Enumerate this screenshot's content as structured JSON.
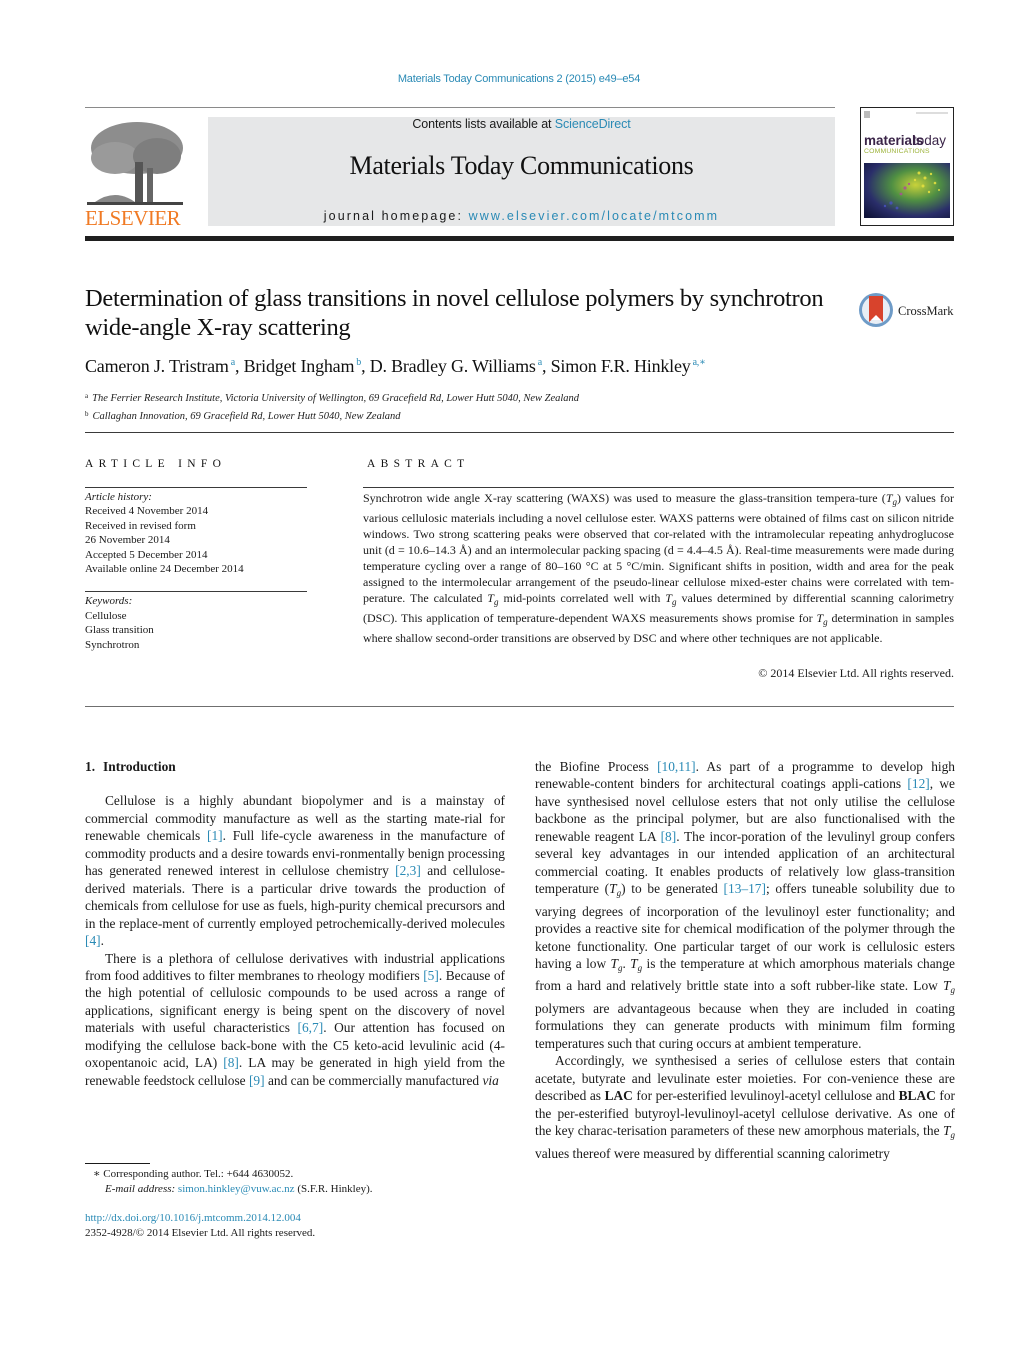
{
  "header": {
    "citation": "Materials Today Communications 2 (2015) e49–e54",
    "contents_prefix": "Contents lists available at ",
    "contents_link": "ScienceDirect",
    "journal_title": "Materials Today Communications",
    "homepage_prefix": "journal homepage: ",
    "homepage_link": "www.elsevier.com/locate/mtcomm",
    "publisher_logo_text": "ELSEVIER",
    "cover_title_bold": "materials",
    "cover_title_light": "today",
    "cover_subtitle": "COMMUNICATIONS"
  },
  "colors": {
    "link": "#2a8ab5",
    "elsevier_orange": "#f07a24",
    "masthead_gray": "#e6e7e8"
  },
  "article": {
    "title": "Determination of glass transitions in novel cellulose polymers by synchrotron wide-angle X-ray scattering",
    "crossmark_label": "CrossMark",
    "authors": [
      {
        "name": "Cameron J. Tristram",
        "aff": "a"
      },
      {
        "name": "Bridget Ingham",
        "aff": "b"
      },
      {
        "name": "D. Bradley G. Williams",
        "aff": "a"
      },
      {
        "name": "Simon F.R. Hinkley",
        "aff": "a,∗"
      }
    ],
    "affiliations": [
      {
        "key": "a",
        "text": "The Ferrier Research Institute, Victoria University of Wellington, 69 Gracefield Rd, Lower Hutt 5040, New Zealand"
      },
      {
        "key": "b",
        "text": "Callaghan Innovation, 69 Gracefield Rd, Lower Hutt 5040, New Zealand"
      }
    ]
  },
  "article_info": {
    "heading": "ARTICLE INFO",
    "history_label": "Article history:",
    "history": [
      "Received 4 November 2014",
      "Received in revised form",
      "26 November 2014",
      "Accepted 5 December 2014",
      "Available online 24 December 2014"
    ],
    "keywords_label": "Keywords:",
    "keywords": [
      "Cellulose",
      "Glass transition",
      "Synchrotron"
    ]
  },
  "abstract": {
    "heading": "ABSTRACT",
    "segments": [
      "Synchrotron wide angle X-ray scattering (WAXS) was used to measure the glass-transition tempera-ture (",
      ") values for various cellulosic materials including a novel cellulose ester. WAXS patterns were obtained of films cast on silicon nitride windows. Two strong scattering peaks were observed that cor-related with the intramolecular repeating anhydroglucose unit (d = 10.6–14.3 Å) and an intermolecular packing spacing (d = 4.4–4.5 Å). Real-time measurements were made during temperature cycling over a range of 80–160 °C at 5 °C/min. Significant shifts in position, width and area for the peak assigned to the intermolecular arrangement of the pseudo-linear cellulose mixed-ester chains were correlated with tem-perature. The calculated ",
      " mid-points correlated well with ",
      " values determined by differential scanning calorimetry (DSC). This application of temperature-dependent WAXS measurements shows promise for ",
      " determination in samples where shallow second-order transitions are observed by DSC and where other techniques are not applicable."
    ],
    "copyright": "© 2014 Elsevier Ltd. All rights reserved."
  },
  "symbols": {
    "T": "T",
    "g": "g"
  },
  "body": {
    "section_number": "1.",
    "section_title": "Introduction",
    "left": {
      "p1": [
        "Cellulose is a highly abundant biopolymer and is a mainstay of commercial commodity manufacture as well as the starting mate-rial for renewable chemicals ",
        "[1]",
        ". Full life-cycle awareness in the manufacture of commodity products and a desire towards envi-ronmentally benign processing has generated renewed interest in cellulose chemistry ",
        "[2,3]",
        " and cellulose-derived materials. There is a particular drive towards the production of chemicals from cellulose for use as fuels, high-purity chemical precursors and in the replace-ment of currently employed petrochemically-derived molecules ",
        "[4]",
        "."
      ],
      "p2": [
        "There is a plethora of cellulose derivatives with industrial applications from food additives to filter membranes to rheology modifiers ",
        "[5]",
        ". Because of the high potential of cellulosic compounds to be used across a range of applications, significant energy is being spent on the discovery of novel materials with useful characteristics ",
        "[6,7]",
        ". Our attention has focused on modifying the cellulose back-bone with the C5 keto-acid levulinic acid (4-oxopentanoic acid, LA) ",
        "[8]",
        ". LA may be generated in high yield from the renewable feedstock cellulose ",
        "[9]",
        " and can be commercially manufactured ",
        "via"
      ]
    },
    "right": {
      "p1": [
        "the Biofine Process ",
        "[10,11]",
        ". As part of a programme to develop high renewable-content binders for architectural coatings appli-cations ",
        "[12]",
        ", we have synthesised novel cellulose esters that not only utilise the cellulose backbone as the principal polymer, but are also functionalised with the renewable reagent LA ",
        "[8]",
        ". The incor-poration of the levulinyl group confers several key advantages in our intended application of an architectural commercial coating. It enables products of relatively low glass-transition temperature (",
        ") to be generated ",
        "[13–17]",
        "; offers tuneable solubility due to varying degrees of incorporation of the levulinoyl ester functionality; and provides a reactive site for chemical modification of the polymer through the ketone functionality. One particular target of our work is cellulosic esters having a low ",
        ". ",
        " is the temperature at which amorphous materials change from a hard and relatively brittle state into a soft rubber-like state. Low ",
        " polymers are advantageous because when they are included in coating formulations they can generate products with minimum film forming temperatures such that curing occurs at ambient temperature."
      ],
      "p2": [
        "Accordingly, we synthesised a series of cellulose esters that contain acetate, butyrate and levulinate ester moieties. For con-venience these are described as ",
        "LAC",
        " for per-esterified levulinoyl-acetyl cellulose and ",
        "BLAC",
        " for the per-esterified butyroyl-levulinoyl-acetyl cellulose derivative. As one of the key charac-terisation parameters of these new amorphous materials, the ",
        " values thereof were measured by differential scanning calorimetry"
      ]
    }
  },
  "footnote": {
    "star": "∗",
    "corresponding": "Corresponding author. Tel.: +644 4630052.",
    "email_label": "E-mail address: ",
    "email": "simon.hinkley@vuw.ac.nz",
    "email_suffix": " (S.F.R. Hinkley)."
  },
  "doi": {
    "url": "http://dx.doi.org/10.1016/j.mtcomm.2014.12.004",
    "issn_line": "2352-4928/© 2014 Elsevier Ltd. All rights reserved."
  }
}
